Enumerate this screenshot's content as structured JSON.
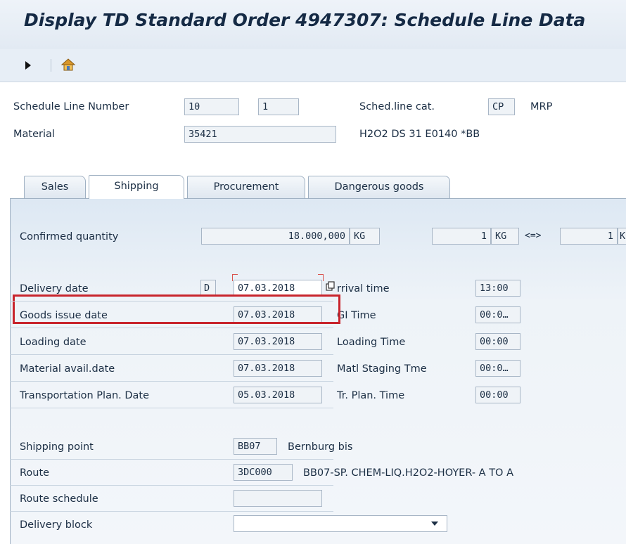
{
  "window": {
    "title": "Display TD Standard Order 4947307: Schedule Line Data"
  },
  "header": {
    "schedule_line_number_label": "Schedule Line Number",
    "schedule_line_number_1": "10",
    "schedule_line_number_2": "1",
    "sched_line_cat_label": "Sched.line cat.",
    "sched_line_cat_value": "CP",
    "sched_line_cat_text": "MRP",
    "material_label": "Material",
    "material_value": "35421",
    "material_description": "H2O2 DS 31 E0140 *BB"
  },
  "tabs": [
    {
      "label": "Sales",
      "active": false
    },
    {
      "label": "Shipping",
      "active": true
    },
    {
      "label": "Procurement",
      "active": false
    },
    {
      "label": "Dangerous goods",
      "active": false
    }
  ],
  "shipping": {
    "confirmed_quantity_label": "Confirmed quantity",
    "confirmed_quantity_value": "18.000,000",
    "confirmed_quantity_unit": "KG",
    "conv_qty_1": "1",
    "conv_unit_1": "KG",
    "conv_symbol": "<=>",
    "conv_qty_2": "1",
    "conv_unit_2": "K",
    "dates": [
      {
        "label": "Delivery date",
        "indicator": "D",
        "date": "07.03.2018",
        "time_label": "rrival time",
        "time": "13:00"
      },
      {
        "label": "Goods issue date",
        "indicator": "",
        "date": "07.03.2018",
        "time_label": "GI Time",
        "time": "00:0…"
      },
      {
        "label": "Loading date",
        "indicator": "",
        "date": "07.03.2018",
        "time_label": "Loading Time",
        "time": "00:00"
      },
      {
        "label": "Material avail.date",
        "indicator": "",
        "date": "07.03.2018",
        "time_label": "Matl Staging Tme",
        "time": "00:0…"
      },
      {
        "label": "Transportation Plan. Date",
        "indicator": "",
        "date": "05.03.2018",
        "time_label": "Tr. Plan. Time",
        "time": "00:00"
      }
    ],
    "shipping_point_label": "Shipping point",
    "shipping_point_value": "BB07",
    "shipping_point_text": "Bernburg bis",
    "route_label": "Route",
    "route_value": "3DC000",
    "route_text": "BB07-SP. CHEM-LIQ.H2O2-HOYER- A TO A",
    "route_schedule_label": "Route schedule",
    "route_schedule_value": "",
    "delivery_block_label": "Delivery block",
    "delivery_block_value": ""
  },
  "icons": {
    "execute": "play-arrow-icon",
    "home": "exit-home-icon",
    "copy": "copy-icon",
    "dropdown": "chevron-down-icon"
  },
  "colors": {
    "highlight": "#c8242c",
    "panel_bg": "#e7eef6",
    "title": "#152a45"
  }
}
